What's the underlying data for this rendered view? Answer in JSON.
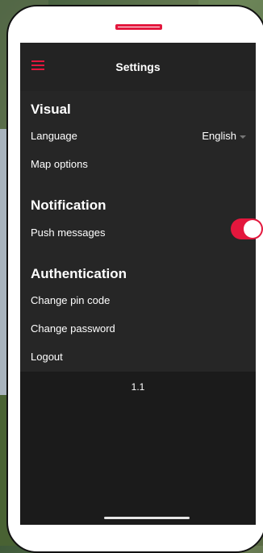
{
  "app": {
    "title": "Settings"
  },
  "sections": {
    "visual": {
      "title": "Visual",
      "language_label": "Language",
      "language_value": "English",
      "map_options_label": "Map options"
    },
    "notification": {
      "title": "Notification",
      "push_label": "Push messages",
      "push_enabled": true
    },
    "authentication": {
      "title": "Authentication",
      "change_pin_label": "Change pin code",
      "change_password_label": "Change password",
      "logout_label": "Logout"
    }
  },
  "version": "1.1",
  "colors": {
    "accent": "#e3173d",
    "background": "#1b1b1b",
    "panel": "#262626"
  },
  "icons": {
    "menu": "hamburger-menu-icon",
    "dropdown": "caret-down-icon"
  }
}
